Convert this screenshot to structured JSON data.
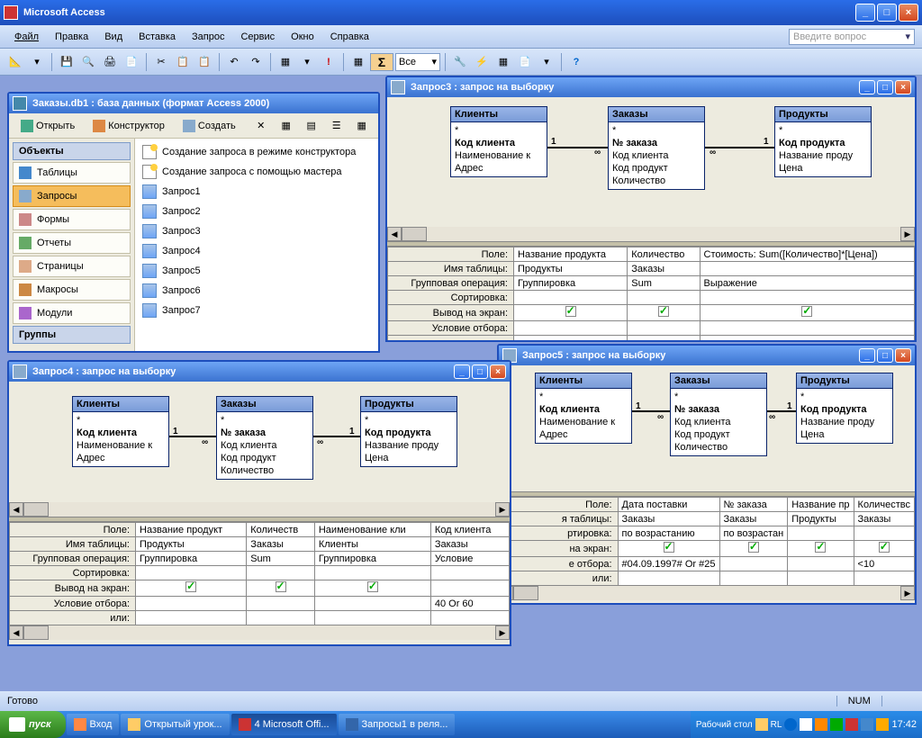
{
  "app": {
    "title": "Microsoft Access"
  },
  "menu": {
    "file": "Файл",
    "edit": "Правка",
    "view": "Вид",
    "insert": "Вставка",
    "query": "Запрос",
    "tools": "Сервис",
    "window": "Окно",
    "help": "Справка",
    "helpph": "Введите вопрос"
  },
  "toolbar": {
    "vse": "Все",
    "sigma": "Σ"
  },
  "dbwin": {
    "title": "Заказы.db1 : база данных (формат Access 2000)",
    "open": "Открыть",
    "design": "Конструктор",
    "create": "Создать",
    "obj_hdr": "Объекты",
    "groups_hdr": "Группы",
    "side": {
      "tables": "Таблицы",
      "queries": "Запросы",
      "forms": "Формы",
      "reports": "Отчеты",
      "pages": "Страницы",
      "macros": "Макросы",
      "modules": "Модули"
    },
    "tmpl1": "Создание запроса в режиме конструктора",
    "tmpl2": "Создание запроса с помощью мастера",
    "q1": "Запрос1",
    "q2": "Запрос2",
    "q3": "Запрос3",
    "q4": "Запрос4",
    "q5": "Запрос5",
    "q6": "Запрос6",
    "q7": "Запрос7"
  },
  "gridlabels": {
    "field": "Поле:",
    "table": "Имя таблицы:",
    "total": "Групповая операция:",
    "sort": "Сортировка:",
    "show": "Вывод на экран:",
    "criteria": "Условие отбора:",
    "or": "или:"
  },
  "tables": {
    "clients": {
      "hdr": "Клиенты",
      "star": "*",
      "pk": "Код клиента",
      "f1": "Наименование к",
      "f2": "Адрес"
    },
    "orders": {
      "hdr": "Заказы",
      "star": "*",
      "pk": "№ заказа",
      "f1": "Код клиента",
      "f2": "Код продукт",
      "f3": "Количество"
    },
    "products": {
      "hdr": "Продукты",
      "star": "*",
      "pk": "Код продукта",
      "f1": "Название проду",
      "f2": "Цена"
    }
  },
  "join": {
    "one": "1",
    "many": "∞"
  },
  "q3": {
    "title": "Запрос3 : запрос на выборку",
    "c1": {
      "field": "Название продукта",
      "table": "Продукты",
      "total": "Группировка"
    },
    "c2": {
      "field": "Количество",
      "table": "Заказы",
      "total": "Sum"
    },
    "c3": {
      "field": "Стоимость: Sum([Количество]*[Цена])",
      "total": "Выражение"
    }
  },
  "q4": {
    "title": "Запрос4 : запрос на выборку",
    "c1": {
      "field": "Название продукт",
      "table": "Продукты",
      "total": "Группировка"
    },
    "c2": {
      "field": "Количеств",
      "table": "Заказы",
      "total": "Sum"
    },
    "c3": {
      "field": "Наименование кли",
      "table": "Клиенты",
      "total": "Группировка"
    },
    "c4": {
      "field": "Код клиента",
      "table": "Заказы",
      "total": "Условие",
      "crit": "40 Or 60"
    }
  },
  "q5": {
    "title": "Запрос5 : запрос на выборку",
    "labels": {
      "field": "Поле:",
      "table": "я таблицы:",
      "sort": "ртировка:",
      "show": "на экран:",
      "crit": "е отбора:",
      "or": "или:"
    },
    "c1": {
      "field": "Дата поставки",
      "table": "Заказы",
      "sort": "по возрастанию",
      "crit": "#04.09.1997# Or #25"
    },
    "c2": {
      "field": "№ заказа",
      "table": "Заказы",
      "sort": "по возрастан"
    },
    "c3": {
      "field": "Название пр",
      "table": "Продукты"
    },
    "c4": {
      "field": "Количествс",
      "table": "Заказы",
      "crit": "<10"
    }
  },
  "status": {
    "ready": "Готово",
    "num": "NUM"
  },
  "taskbar": {
    "start": "пуск",
    "t1": "Вход",
    "t2": "Открытый урок...",
    "t3": "4 Microsoft Offi...",
    "t4": "Запросы1 в реля...",
    "desktop": "Рабочий стол",
    "lang": "RL",
    "time": "17:42"
  }
}
